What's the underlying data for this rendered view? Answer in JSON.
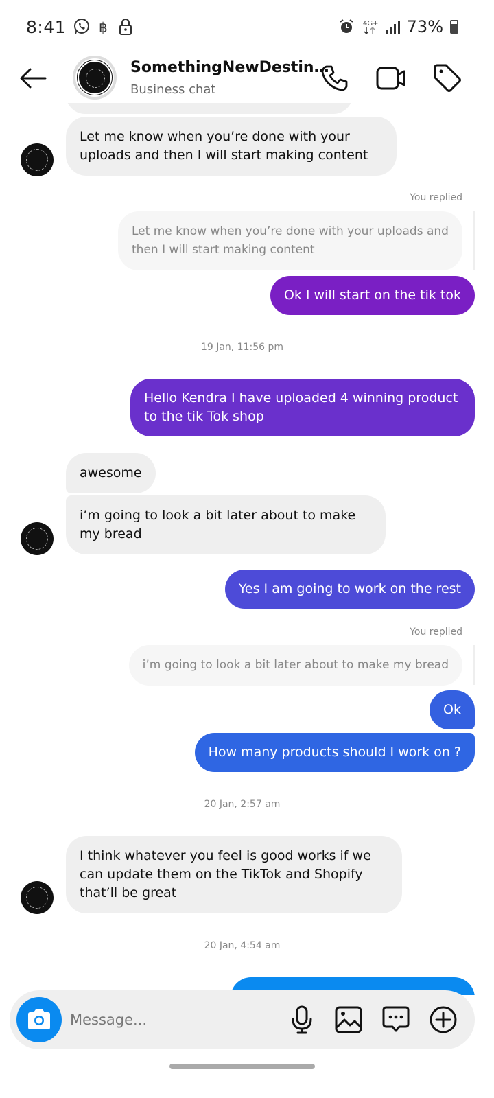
{
  "status_bar": {
    "time": "8:41",
    "network": "4G+",
    "battery_percent": "73%",
    "battery_level": 0.73,
    "left_icons": [
      "whatsapp-icon",
      "bitcoin-icon",
      "lock-icon"
    ],
    "right_icons": [
      "alarm-icon",
      "network-4g-icon",
      "signal-icon",
      "battery-icon"
    ]
  },
  "header": {
    "title": "SomethingNewDestin…",
    "subtitle": "Business chat",
    "actions": [
      "phone-icon",
      "video-icon",
      "tag-icon"
    ]
  },
  "messages": [
    {
      "type": "in",
      "text": "Let me know when you’re done with your uploads and then I will start making content"
    },
    {
      "type": "reply_label",
      "text": "You replied"
    },
    {
      "type": "reply_quote",
      "text": "Let me know when you’re done with your uploads and then I will start making content"
    },
    {
      "type": "out",
      "text": "Ok I will start on the tik tok",
      "color": "#7a1fc4"
    },
    {
      "type": "timestamp",
      "text": "19 Jan, 11:56 pm"
    },
    {
      "type": "out",
      "text": "Hello Kendra I have uploaded 4 winning  product to the tik Tok shop",
      "color": "#6a30cc"
    },
    {
      "type": "in",
      "text": "awesome"
    },
    {
      "type": "in",
      "text": "i’m going to look a bit later   about to make my bread"
    },
    {
      "type": "out",
      "text": "Yes I am going to work on the rest",
      "color": "#4d4bd8"
    },
    {
      "type": "reply_label",
      "text": "You replied"
    },
    {
      "type": "reply_quote",
      "text": "i’m going to look a bit later   about to make my bread"
    },
    {
      "type": "out",
      "text": "Ok",
      "color": "#3460e0"
    },
    {
      "type": "out",
      "text": "How many products should I work on ?",
      "color": "#2f66e3"
    },
    {
      "type": "timestamp",
      "text": "20 Jan, 2:57 am"
    },
    {
      "type": "in",
      "text": "I think whatever you feel is good works if we can update them on the TikTok and Shopify that’ll be great"
    },
    {
      "type": "timestamp",
      "text": "20 Jan, 4:54 am"
    },
    {
      "type": "out",
      "text": "",
      "color": "#0a8af0"
    }
  ],
  "composer": {
    "placeholder": "Message...",
    "icons": [
      "camera-icon",
      "microphone-icon",
      "gallery-icon",
      "sticker-icon",
      "add-icon"
    ]
  },
  "colors": {
    "accent_blue": "#0a8af0",
    "incoming_bubble": "#efefef",
    "reply_quote_bg": "#f6f6f6"
  }
}
